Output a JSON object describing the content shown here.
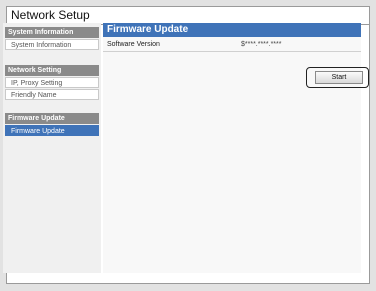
{
  "window": {
    "title": "Network Setup"
  },
  "sidebar": {
    "sections": [
      {
        "header": "System Information",
        "items": [
          "System Information"
        ]
      },
      {
        "header": "Network Setting",
        "items": [
          "IP, Proxy Setting",
          "Friendly Name"
        ]
      },
      {
        "header": "Firmware Update",
        "items": [
          "Firmware Update"
        ]
      }
    ],
    "active_item": "Firmware Update"
  },
  "main": {
    "header": "Firmware Update",
    "row": {
      "label": "Software Version",
      "value": "$****.****.****"
    },
    "start_button": {
      "label": "Start"
    }
  },
  "colors": {
    "accent": "#3f73b8",
    "section_header": "#8a8a8a"
  }
}
